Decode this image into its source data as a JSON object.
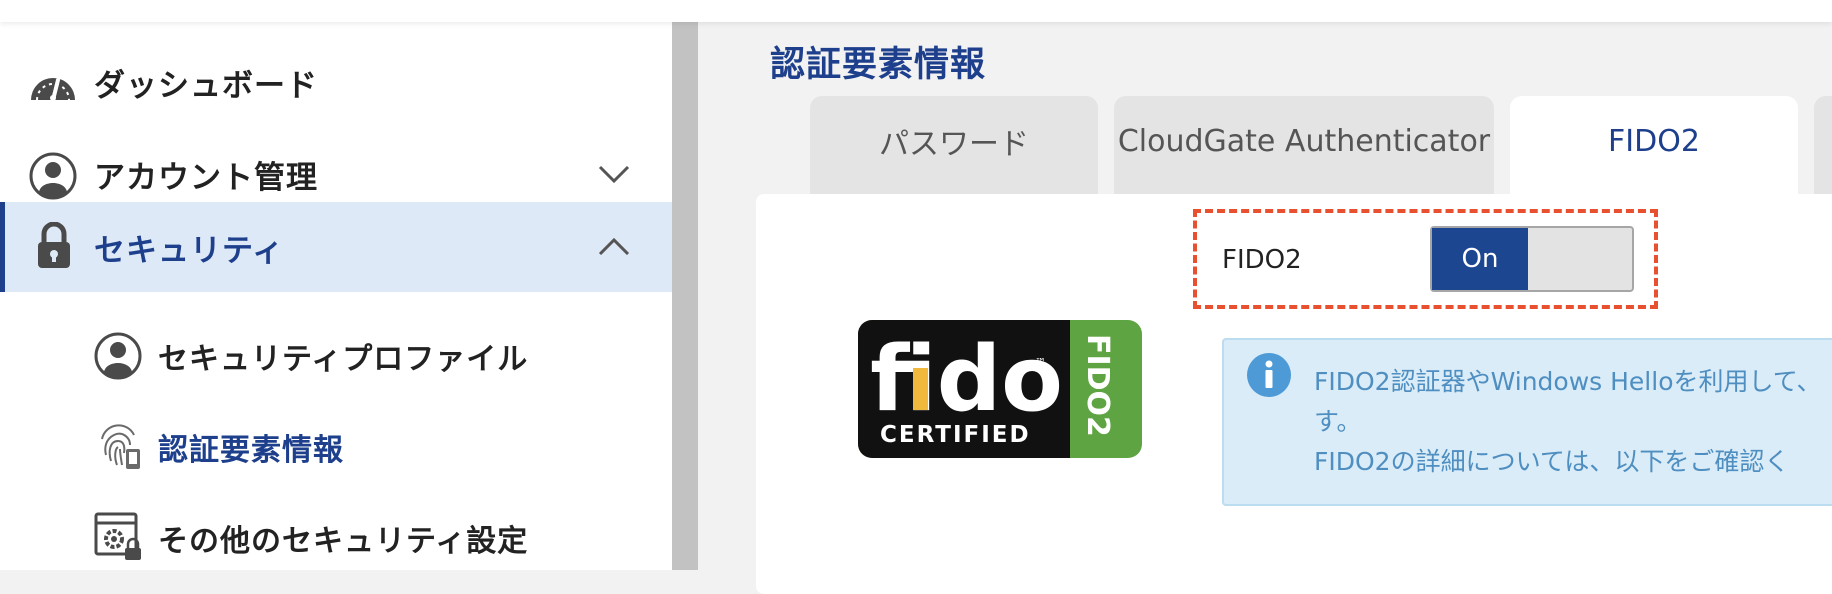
{
  "sidebar": {
    "items": [
      {
        "label": "ダッシュボード"
      },
      {
        "label": "アカウント管理"
      },
      {
        "label": "セキュリティ"
      },
      {
        "label": "セキュリティプロファイル"
      },
      {
        "label": "認証要素情報"
      },
      {
        "label": "その他のセキュリティ設定"
      }
    ]
  },
  "main": {
    "title": "認証要素情報",
    "tabs": [
      {
        "label": "パスワード"
      },
      {
        "label": "CloudGate Authenticator"
      },
      {
        "label": "FIDO2"
      }
    ],
    "toggle": {
      "label": "FIDO2",
      "state": "On"
    },
    "logo": {
      "word": "fido",
      "certified": "CERTIFIED",
      "band": "FIDO2",
      "tm": "™"
    },
    "info": {
      "line1": "FIDO2認証器やWindows Helloを利用して、",
      "line2": "す。",
      "line3": "FIDO2の詳細については、以下をご確認く"
    }
  },
  "colors": {
    "primary": "#1d3f8c",
    "active_bg": "#dde9f6",
    "highlight": "#e8502f",
    "fido_green": "#5fa442",
    "fido_gold": "#f0b83c",
    "info_text": "#4f8ec0"
  }
}
